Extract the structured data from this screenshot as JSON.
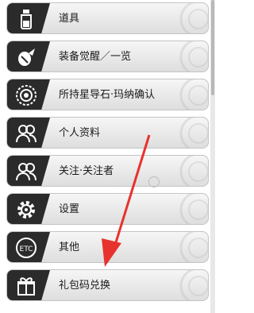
{
  "menu": {
    "items": [
      {
        "label": "道具",
        "icon": "potion-bottle-icon"
      },
      {
        "label": "装备觉醒／一览",
        "icon": "equipment-awaken-icon"
      },
      {
        "label": "所持星导石·玛纳确认",
        "icon": "star-stone-icon"
      },
      {
        "label": "个人资料",
        "icon": "profile-users-icon"
      },
      {
        "label": "关注·关注者",
        "icon": "follow-users-icon"
      },
      {
        "label": "设置",
        "icon": "gear-icon"
      },
      {
        "label": "其他",
        "icon": "etc-icon"
      },
      {
        "label": "礼包码兑换",
        "icon": "gift-box-icon"
      }
    ]
  },
  "etc_icon_text": "ETC",
  "annotation": {
    "arrow_color": "#e8322d"
  }
}
